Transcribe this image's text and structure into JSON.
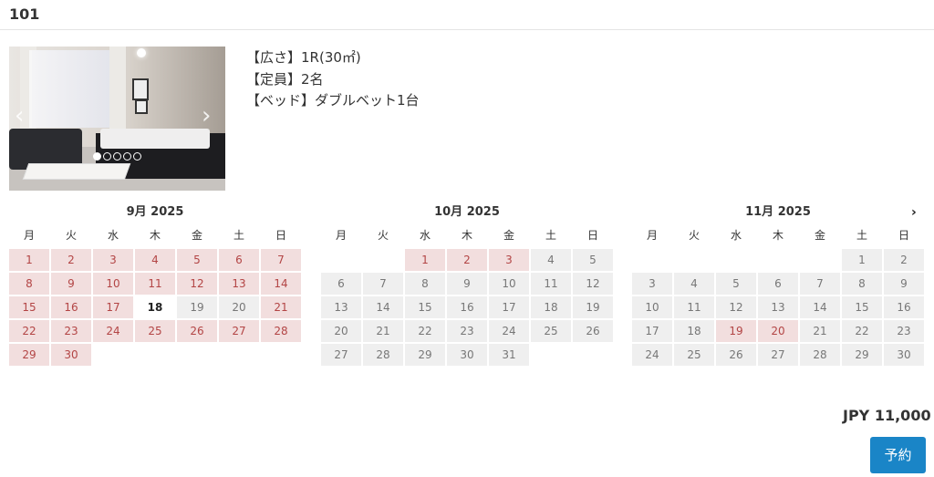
{
  "room": {
    "title": "101"
  },
  "carousel": {
    "prev_icon": "chevron-left-icon",
    "next_icon": "chevron-right-icon",
    "slides": 5,
    "active": 1
  },
  "specs": {
    "size": "【広さ】1R(30㎡)",
    "capacity": "【定員】2名",
    "bed": "【ベッド】ダブルベット1台"
  },
  "colors": {
    "available_bg": "#f2dede",
    "available_text": "#b34545",
    "past_bg": "#efefef",
    "button": "#1a85c7"
  },
  "weekdays": [
    "月",
    "火",
    "水",
    "木",
    "金",
    "土",
    "日"
  ],
  "calendars": [
    {
      "title": "9月 2025",
      "days": [
        {
          "d": "1",
          "s": "avail"
        },
        {
          "d": "2",
          "s": "avail"
        },
        {
          "d": "3",
          "s": "avail"
        },
        {
          "d": "4",
          "s": "avail"
        },
        {
          "d": "5",
          "s": "avail"
        },
        {
          "d": "6",
          "s": "avail"
        },
        {
          "d": "7",
          "s": "avail"
        },
        {
          "d": "8",
          "s": "avail"
        },
        {
          "d": "9",
          "s": "avail"
        },
        {
          "d": "10",
          "s": "avail"
        },
        {
          "d": "11",
          "s": "avail"
        },
        {
          "d": "12",
          "s": "avail"
        },
        {
          "d": "13",
          "s": "avail"
        },
        {
          "d": "14",
          "s": "avail"
        },
        {
          "d": "15",
          "s": "avail"
        },
        {
          "d": "16",
          "s": "avail"
        },
        {
          "d": "17",
          "s": "avail"
        },
        {
          "d": "18",
          "s": "today"
        },
        {
          "d": "19",
          "s": "past"
        },
        {
          "d": "20",
          "s": "past"
        },
        {
          "d": "21",
          "s": "avail"
        },
        {
          "d": "22",
          "s": "avail"
        },
        {
          "d": "23",
          "s": "avail"
        },
        {
          "d": "24",
          "s": "avail"
        },
        {
          "d": "25",
          "s": "avail"
        },
        {
          "d": "26",
          "s": "avail"
        },
        {
          "d": "27",
          "s": "avail"
        },
        {
          "d": "28",
          "s": "avail"
        },
        {
          "d": "29",
          "s": "avail"
        },
        {
          "d": "30",
          "s": "avail"
        }
      ]
    },
    {
      "title": "10月 2025",
      "days": [
        {
          "d": "",
          "s": "empty"
        },
        {
          "d": "",
          "s": "empty"
        },
        {
          "d": "1",
          "s": "avail"
        },
        {
          "d": "2",
          "s": "avail"
        },
        {
          "d": "3",
          "s": "avail"
        },
        {
          "d": "4",
          "s": "past"
        },
        {
          "d": "5",
          "s": "past"
        },
        {
          "d": "6",
          "s": "past"
        },
        {
          "d": "7",
          "s": "past"
        },
        {
          "d": "8",
          "s": "past"
        },
        {
          "d": "9",
          "s": "past"
        },
        {
          "d": "10",
          "s": "past"
        },
        {
          "d": "11",
          "s": "past"
        },
        {
          "d": "12",
          "s": "past"
        },
        {
          "d": "13",
          "s": "past"
        },
        {
          "d": "14",
          "s": "past"
        },
        {
          "d": "15",
          "s": "past"
        },
        {
          "d": "16",
          "s": "past"
        },
        {
          "d": "17",
          "s": "past"
        },
        {
          "d": "18",
          "s": "past"
        },
        {
          "d": "19",
          "s": "past"
        },
        {
          "d": "20",
          "s": "past"
        },
        {
          "d": "21",
          "s": "past"
        },
        {
          "d": "22",
          "s": "past"
        },
        {
          "d": "23",
          "s": "past"
        },
        {
          "d": "24",
          "s": "past"
        },
        {
          "d": "25",
          "s": "past"
        },
        {
          "d": "26",
          "s": "past"
        },
        {
          "d": "27",
          "s": "past"
        },
        {
          "d": "28",
          "s": "past"
        },
        {
          "d": "29",
          "s": "past"
        },
        {
          "d": "30",
          "s": "past"
        },
        {
          "d": "31",
          "s": "past"
        }
      ]
    },
    {
      "title": "11月 2025",
      "days": [
        {
          "d": "",
          "s": "empty"
        },
        {
          "d": "",
          "s": "empty"
        },
        {
          "d": "",
          "s": "empty"
        },
        {
          "d": "",
          "s": "empty"
        },
        {
          "d": "",
          "s": "empty"
        },
        {
          "d": "1",
          "s": "past"
        },
        {
          "d": "2",
          "s": "past"
        },
        {
          "d": "3",
          "s": "past"
        },
        {
          "d": "4",
          "s": "past"
        },
        {
          "d": "5",
          "s": "past"
        },
        {
          "d": "6",
          "s": "past"
        },
        {
          "d": "7",
          "s": "past"
        },
        {
          "d": "8",
          "s": "past"
        },
        {
          "d": "9",
          "s": "past"
        },
        {
          "d": "10",
          "s": "past"
        },
        {
          "d": "11",
          "s": "past"
        },
        {
          "d": "12",
          "s": "past"
        },
        {
          "d": "13",
          "s": "past"
        },
        {
          "d": "14",
          "s": "past"
        },
        {
          "d": "15",
          "s": "past"
        },
        {
          "d": "16",
          "s": "past"
        },
        {
          "d": "17",
          "s": "past"
        },
        {
          "d": "18",
          "s": "past"
        },
        {
          "d": "19",
          "s": "avail"
        },
        {
          "d": "20",
          "s": "avail"
        },
        {
          "d": "21",
          "s": "past"
        },
        {
          "d": "22",
          "s": "past"
        },
        {
          "d": "23",
          "s": "past"
        },
        {
          "d": "24",
          "s": "past"
        },
        {
          "d": "25",
          "s": "past"
        },
        {
          "d": "26",
          "s": "past"
        },
        {
          "d": "27",
          "s": "past"
        },
        {
          "d": "28",
          "s": "past"
        },
        {
          "d": "29",
          "s": "past"
        },
        {
          "d": "30",
          "s": "past"
        }
      ]
    }
  ],
  "next_month_icon": "chevron-right-icon",
  "price": "JPY 11,000",
  "book_label": "予約"
}
